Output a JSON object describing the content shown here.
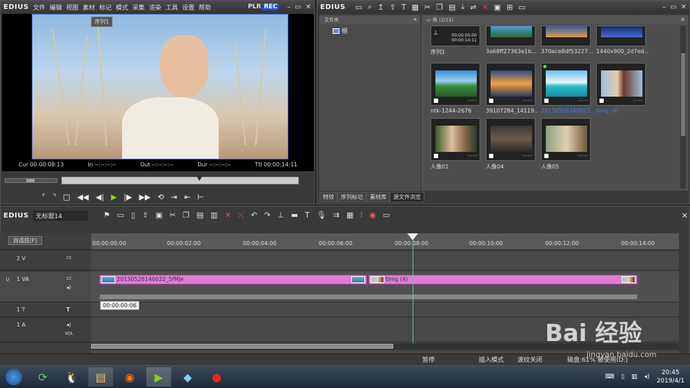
{
  "player": {
    "brand": "EDIUS",
    "menu": [
      "文件",
      "编辑",
      "视图",
      "素材",
      "标记",
      "模式",
      "采集",
      "渲染",
      "工具",
      "设置",
      "帮助"
    ],
    "plr": "PLR",
    "rec": "REC",
    "cur": "Cur 00:00:08:13",
    "in": "In --:--:--:--",
    "out": "Out --:--:--:--",
    "dur": "Dur --:--:--:--",
    "ttl": "Ttl 00:00:14:11"
  },
  "bin": {
    "brand": "EDIUS",
    "folder_header": "文件夹",
    "root_folder": "根",
    "thumbs_header": "根 (2/11)",
    "clips": [
      {
        "name": "序列1",
        "timecode": "00:00:00:00\n00:00:14:11"
      },
      {
        "name": "3a68ff27363e1b..."
      },
      {
        "name": "370ace8df53227..."
      },
      {
        "name": "1440x900_2d7ed..."
      },
      {
        "name": "ntk-1244-2676"
      },
      {
        "name": "39107284_14119..."
      },
      {
        "name": "20130526140022..."
      },
      {
        "name": "timg (4)"
      },
      {
        "name": "人像01"
      },
      {
        "name": "人像04"
      },
      {
        "name": "人像05"
      }
    ],
    "tabs": [
      "特效",
      "序列标记",
      "素材库",
      "源文件浏览"
    ]
  },
  "timeline": {
    "brand": "EDIUS",
    "project": "无标题14",
    "sequence_tab": "序列1",
    "track_mode": "自适应(F)",
    "ticks": [
      "00:00:00:00",
      "00:00:02:00",
      "00:00:04:00",
      "00:00:06:00",
      "00:00:08:00",
      "00:00:10:00",
      "00:00:12:00",
      "00:00:14:00"
    ],
    "tracks": [
      "2 V",
      "1 VA",
      "1 T",
      "1 A"
    ],
    "clip1": "20130526140022_5fMJe",
    "clip2": "timg (4)",
    "tooltip": "00:00:00:06",
    "status": {
      "pause": "暂停",
      "insert": "插入模式",
      "ripple": "波纹关闭",
      "disk": "磁盘:61% 被使用(D:)"
    }
  },
  "taskbar": {
    "time": "20:45",
    "date": "2019/4/1"
  },
  "watermark": {
    "logo": "Bai 经验",
    "url": "jingyan.baidu.com"
  }
}
